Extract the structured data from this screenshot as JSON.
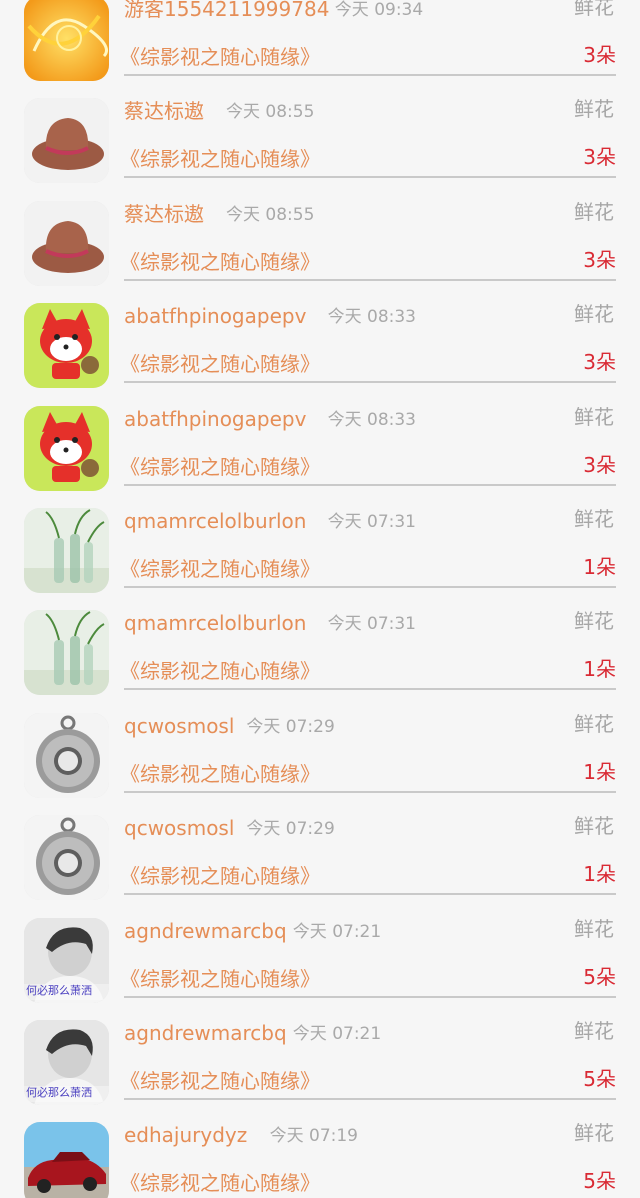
{
  "rows": [
    {
      "user": "游客1554211999784",
      "time": "今天 09:34",
      "gift": "鲜花",
      "work": "《综影视之随心随缘》",
      "count": "3朵",
      "avatar": "orange-swirl"
    },
    {
      "user": "蔡达标遨",
      "time": "今天 08:55",
      "gift": "鲜花",
      "work": "《综影视之随心随缘》",
      "count": "3朵",
      "avatar": "hat"
    },
    {
      "user": "蔡达标遨",
      "time": "今天 08:55",
      "gift": "鲜花",
      "work": "《综影视之随心随缘》",
      "count": "3朵",
      "avatar": "hat"
    },
    {
      "user": "abatfhpinogapepv",
      "time": "今天 08:33",
      "gift": "鲜花",
      "work": "《综影视之随心随缘》",
      "count": "3朵",
      "avatar": "fox"
    },
    {
      "user": "abatfhpinogapepv",
      "time": "今天 08:33",
      "gift": "鲜花",
      "work": "《综影视之随心随缘》",
      "count": "3朵",
      "avatar": "fox"
    },
    {
      "user": "qmamrcelolburlon",
      "time": "今天 07:31",
      "gift": "鲜花",
      "work": "《综影视之随心随缘》",
      "count": "1朵",
      "avatar": "bottles"
    },
    {
      "user": "qmamrcelolburlon",
      "time": "今天 07:31",
      "gift": "鲜花",
      "work": "《综影视之随心随缘》",
      "count": "1朵",
      "avatar": "bottles"
    },
    {
      "user": "qcwosmosl",
      "time": "今天 07:29",
      "gift": "鲜花",
      "work": "《综影视之随心随缘》",
      "count": "1朵",
      "avatar": "watch"
    },
    {
      "user": "qcwosmosl",
      "time": "今天 07:29",
      "gift": "鲜花",
      "work": "《综影视之随心随缘》",
      "count": "1朵",
      "avatar": "watch"
    },
    {
      "user": "agndrewmarcbq",
      "time": "今天 07:21",
      "gift": "鲜花",
      "work": "《综影视之随心随缘》",
      "count": "5朵",
      "avatar": "portrait",
      "avatar_caption": "何必那么萧洒"
    },
    {
      "user": "agndrewmarcbq",
      "time": "今天 07:21",
      "gift": "鲜花",
      "work": "《综影视之随心随缘》",
      "count": "5朵",
      "avatar": "portrait",
      "avatar_caption": "何必那么萧洒"
    },
    {
      "user": "edhajurydyz",
      "time": "今天 07:19",
      "gift": "鲜花",
      "work": "《综影视之随心随缘》",
      "count": "5朵",
      "avatar": "car"
    }
  ],
  "colors": {
    "username": "#e58e57",
    "time": "#a9a9a9",
    "gift": "#a6a6a6",
    "count": "#d92a34",
    "background": "#f6f6f6",
    "divider": "#c9c9c9"
  }
}
